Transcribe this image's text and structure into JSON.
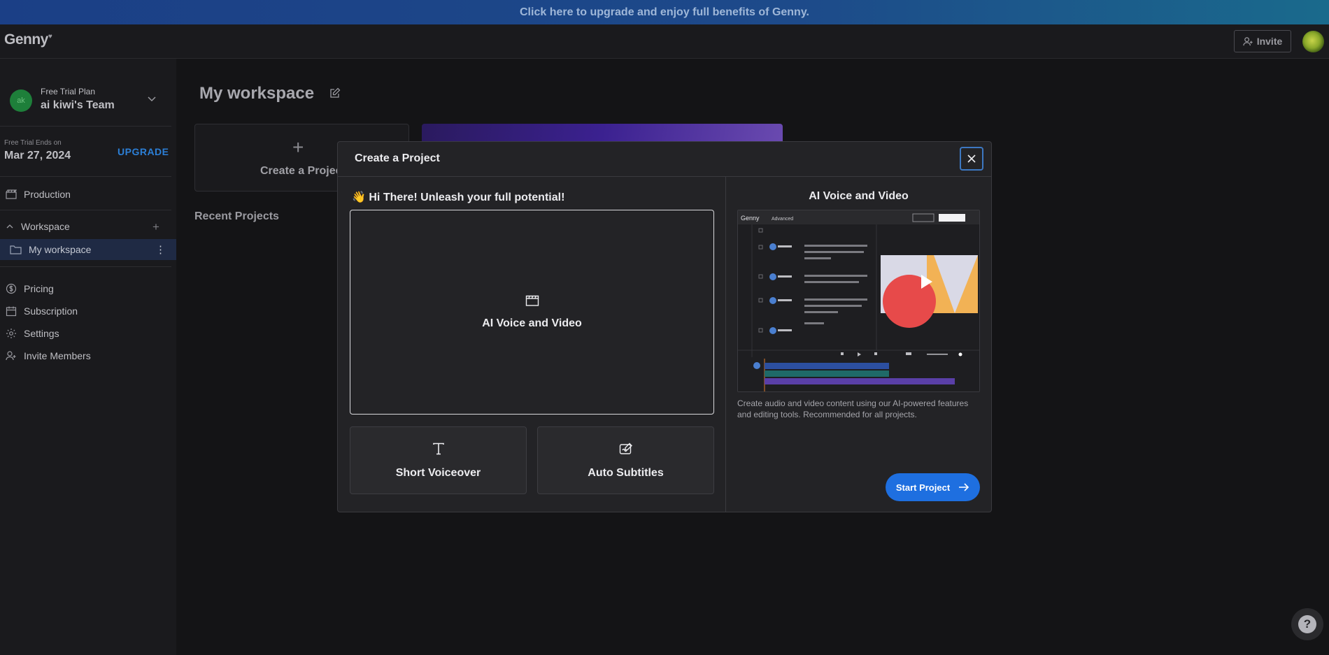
{
  "banner": {
    "text": "Click here to upgrade and enjoy full benefits of Genny."
  },
  "topbar": {
    "logo": "Genny",
    "invite_label": "Invite"
  },
  "sidebar": {
    "team_initials": "ak",
    "plan": "Free Trial Plan",
    "team_name": "ai kiwi's Team",
    "trial_label": "Free Trial Ends on",
    "trial_date": "Mar 27, 2024",
    "upgrade_label": "UPGRADE",
    "production_label": "Production",
    "workspace_label": "Workspace",
    "workspace_item": "My workspace",
    "items": [
      {
        "label": "Pricing",
        "icon": "dollar-icon"
      },
      {
        "label": "Subscription",
        "icon": "calendar-icon"
      },
      {
        "label": "Settings",
        "icon": "gear-icon"
      },
      {
        "label": "Invite Members",
        "icon": "add-user-icon"
      }
    ]
  },
  "main": {
    "title": "My workspace",
    "create_label": "Create a Project",
    "recent_label": "Recent Projects"
  },
  "modal": {
    "title": "Create a Project",
    "greeting": "👋 Hi There! Unleash your full potential!",
    "options": {
      "main": "AI Voice and Video",
      "voiceover": "Short Voiceover",
      "subtitles": "Auto Subtitles"
    },
    "right_title": "AI Voice and Video",
    "preview": {
      "logo": "Genny",
      "mode": "Advanced"
    },
    "description": "Create audio and video content using our AI-powered features and editing tools. Recommended for all projects.",
    "start_label": "Start Project"
  },
  "help": {
    "label": "?"
  },
  "colors": {
    "accent": "#1e6fe0",
    "banner": "#1b3f86",
    "upgrade": "#2c7fd6",
    "background": "#141416"
  }
}
